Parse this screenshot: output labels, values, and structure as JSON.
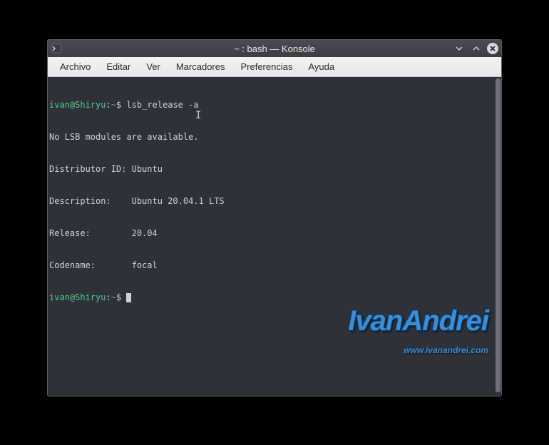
{
  "window": {
    "title": "~ : bash — Konsole"
  },
  "menu": {
    "items": [
      "Archivo",
      "Editar",
      "Ver",
      "Marcadores",
      "Preferencias",
      "Ayuda"
    ]
  },
  "terminal": {
    "prompt_user": "ivan@Shiryu",
    "prompt_path": "~",
    "prompt_symbol": "$",
    "command1": "lsb_release -a",
    "output": {
      "line1": "No LSB modules are available.",
      "line2": "Distributor ID: Ubuntu",
      "line3": "Description:    Ubuntu 20.04.1 LTS",
      "line4": "Release:        20.04",
      "line5": "Codename:       focal"
    }
  },
  "watermark": {
    "name": "IvanAndrei",
    "url": "www.ivanandrei.com"
  }
}
